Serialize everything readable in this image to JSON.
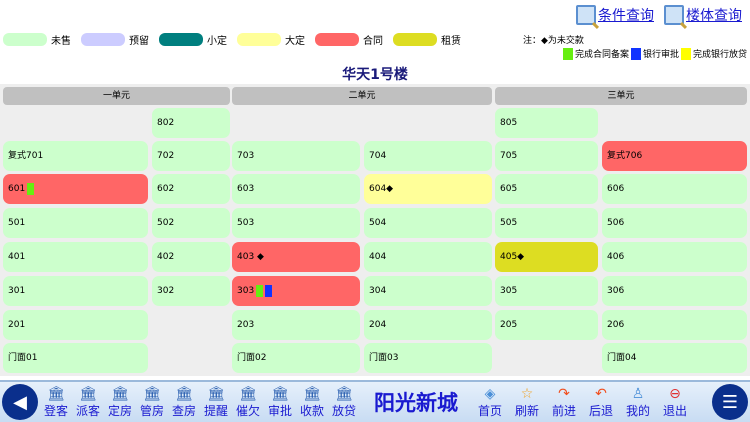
{
  "links": [
    {
      "label": "条件查询",
      "icon": "search-icon"
    },
    {
      "label": "楼体查询",
      "icon": "search-icon"
    }
  ],
  "legend": [
    {
      "label": "未售",
      "color": "#ccffcc"
    },
    {
      "label": "预留",
      "color": "#ccccff"
    },
    {
      "label": "小定",
      "color": "#007f7f"
    },
    {
      "label": "大定",
      "color": "#ffff99"
    },
    {
      "label": "合同",
      "color": "#ff6666"
    },
    {
      "label": "租赁",
      "color": "#dddd22"
    }
  ],
  "note": "注：◆为未交款",
  "marks": [
    {
      "label": "完成合同备案",
      "color": "#66ee11"
    },
    {
      "label": "银行审批",
      "color": "#1133ff"
    },
    {
      "label": "完成银行放贷",
      "color": "#ffff00"
    }
  ],
  "building_title": "华天1号楼",
  "units": [
    "一单元",
    "二单元",
    "三单元"
  ],
  "cells": [
    {
      "row": 0,
      "col": 1,
      "label": "802",
      "status": "未售"
    },
    {
      "row": 0,
      "col": 4,
      "label": "805",
      "status": "未售"
    },
    {
      "row": 1,
      "col": 0,
      "label": "复式701",
      "status": "未售"
    },
    {
      "row": 1,
      "col": 1,
      "label": "702",
      "status": "未售"
    },
    {
      "row": 1,
      "col": 2,
      "label": "703",
      "status": "未售"
    },
    {
      "row": 1,
      "col": 3,
      "label": "704",
      "status": "未售"
    },
    {
      "row": 1,
      "col": 4,
      "label": "705",
      "status": "未售"
    },
    {
      "row": 1,
      "col": 5,
      "label": "复式706",
      "status": "合同"
    },
    {
      "row": 2,
      "col": 0,
      "label": "601",
      "status": "合同",
      "marks": [
        "#66ee11"
      ]
    },
    {
      "row": 2,
      "col": 1,
      "label": "602",
      "status": "未售"
    },
    {
      "row": 2,
      "col": 2,
      "label": "603",
      "status": "未售"
    },
    {
      "row": 2,
      "col": 3,
      "label": "604◆",
      "status": "大定"
    },
    {
      "row": 2,
      "col": 4,
      "label": "605",
      "status": "未售"
    },
    {
      "row": 2,
      "col": 5,
      "label": "606",
      "status": "未售"
    },
    {
      "row": 3,
      "col": 0,
      "label": "501",
      "status": "未售"
    },
    {
      "row": 3,
      "col": 1,
      "label": "502",
      "status": "未售"
    },
    {
      "row": 3,
      "col": 2,
      "label": "503",
      "status": "未售"
    },
    {
      "row": 3,
      "col": 3,
      "label": "504",
      "status": "未售"
    },
    {
      "row": 3,
      "col": 4,
      "label": "505",
      "status": "未售"
    },
    {
      "row": 3,
      "col": 5,
      "label": "506",
      "status": "未售"
    },
    {
      "row": 4,
      "col": 0,
      "label": "401",
      "status": "未售"
    },
    {
      "row": 4,
      "col": 1,
      "label": "402",
      "status": "未售"
    },
    {
      "row": 4,
      "col": 2,
      "label": "403 ◆",
      "status": "合同"
    },
    {
      "row": 4,
      "col": 3,
      "label": "404",
      "status": "未售"
    },
    {
      "row": 4,
      "col": 4,
      "label": "405◆",
      "status": "租赁"
    },
    {
      "row": 4,
      "col": 5,
      "label": "406",
      "status": "未售"
    },
    {
      "row": 5,
      "col": 0,
      "label": "301",
      "status": "未售"
    },
    {
      "row": 5,
      "col": 1,
      "label": "302",
      "status": "未售"
    },
    {
      "row": 5,
      "col": 2,
      "label": "303",
      "status": "合同",
      "marks": [
        "#66ee11",
        "#1133ff"
      ]
    },
    {
      "row": 5,
      "col": 3,
      "label": "304",
      "status": "未售"
    },
    {
      "row": 5,
      "col": 4,
      "label": "305",
      "status": "未售"
    },
    {
      "row": 5,
      "col": 5,
      "label": "306",
      "status": "未售"
    },
    {
      "row": 6,
      "col": 0,
      "label": "201",
      "status": "未售"
    },
    {
      "row": 6,
      "col": 2,
      "label": "203",
      "status": "未售"
    },
    {
      "row": 6,
      "col": 3,
      "label": "204",
      "status": "未售"
    },
    {
      "row": 6,
      "col": 4,
      "label": "205",
      "status": "未售"
    },
    {
      "row": 6,
      "col": 5,
      "label": "206",
      "status": "未售"
    },
    {
      "row": 7,
      "col": 0,
      "label": "门面01",
      "status": "未售"
    },
    {
      "row": 7,
      "col": 2,
      "label": "门面02",
      "status": "未售"
    },
    {
      "row": 7,
      "col": 3,
      "label": "门面03",
      "status": "未售"
    },
    {
      "row": 7,
      "col": 5,
      "label": "门面04",
      "status": "未售"
    }
  ],
  "nav_left": [
    "登客",
    "派客",
    "定房",
    "管房",
    "查房",
    "提醒",
    "催欠",
    "审批",
    "收款",
    "放贷"
  ],
  "brand": "阳光新城",
  "nav_right": [
    {
      "label": "首页",
      "icon": "layers-icon"
    },
    {
      "label": "刷新",
      "icon": "star-icon"
    },
    {
      "label": "前进",
      "icon": "forward-icon"
    },
    {
      "label": "后退",
      "icon": "back-icon"
    },
    {
      "label": "我的",
      "icon": "user-icon"
    },
    {
      "label": "退出",
      "icon": "exit-icon"
    }
  ]
}
